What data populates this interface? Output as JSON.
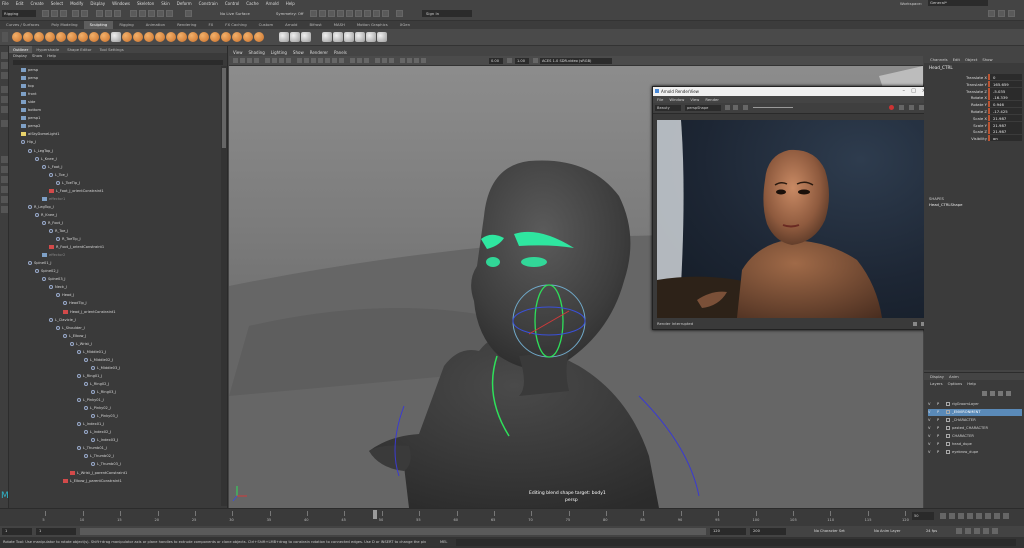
{
  "menubar": [
    "File",
    "Edit",
    "Create",
    "Select",
    "Modify",
    "Display",
    "Windows",
    "Skeleton",
    "Skin",
    "Deform",
    "Constrain",
    "Control",
    "Cache",
    "Arnold",
    "Help"
  ],
  "workspace": {
    "label": "Workspace:",
    "value": "General*"
  },
  "statusline": {
    "mode": "Rigging",
    "no_live": "No Live Surface",
    "symmetry": "Symmetry: Off",
    "signin": "Sign In"
  },
  "shelf_tabs": [
    "Curves / Surfaces",
    "Poly Modeling",
    "Sculpting",
    "Rigging",
    "Animation",
    "Rendering",
    "FX",
    "FX Caching",
    "Custom",
    "Arnold",
    "Bifrost",
    "MASH",
    "Motion Graphics",
    "XGen"
  ],
  "shelf_active": "Sculpting",
  "outliner": {
    "tabs": [
      "Outliner",
      "Hypershade",
      "Shape Editor",
      "Tool Settings"
    ],
    "active_tab": "Outliner",
    "menu": [
      "Display",
      "Show",
      "Help"
    ],
    "rows": [
      {
        "t": "persp",
        "d": 0,
        "k": "c"
      },
      {
        "t": "persp",
        "d": 0,
        "k": "c"
      },
      {
        "t": "top",
        "d": 0,
        "k": "c"
      },
      {
        "t": "front",
        "d": 0,
        "k": "c"
      },
      {
        "t": "side",
        "d": 0,
        "k": "c"
      },
      {
        "t": "bottom",
        "d": 0,
        "k": "c"
      },
      {
        "t": "persp1",
        "d": 0,
        "k": "c"
      },
      {
        "t": "persp2",
        "d": 0,
        "k": "c"
      },
      {
        "t": "aiSkyDomeLight1",
        "d": 0,
        "k": "l"
      },
      {
        "t": "Hip_J",
        "d": 0,
        "k": "j"
      },
      {
        "t": "L_LegTop_J",
        "d": 1,
        "k": "j"
      },
      {
        "t": "L_Knee_J",
        "d": 2,
        "k": "j"
      },
      {
        "t": "L_Foot_J",
        "d": 3,
        "k": "j"
      },
      {
        "t": "L_Toe_J",
        "d": 4,
        "k": "j"
      },
      {
        "t": "L_ToeTip_J",
        "d": 5,
        "k": "j"
      },
      {
        "t": "L_Foot_J_orientConstraint1",
        "d": 4,
        "k": "c"
      },
      {
        "t": "effector1",
        "d": 3,
        "k": "g"
      },
      {
        "t": "R_LegTop_J",
        "d": 1,
        "k": "j"
      },
      {
        "t": "R_Knee_J",
        "d": 2,
        "k": "j"
      },
      {
        "t": "R_Foot_J",
        "d": 3,
        "k": "j"
      },
      {
        "t": "R_Toe_J",
        "d": 4,
        "k": "j"
      },
      {
        "t": "R_ToeTip_J",
        "d": 5,
        "k": "j"
      },
      {
        "t": "R_Foot_J_orientConstraint1",
        "d": 4,
        "k": "c"
      },
      {
        "t": "effector2",
        "d": 3,
        "k": "g"
      },
      {
        "t": "Spine01_J",
        "d": 1,
        "k": "j"
      },
      {
        "t": "Spine02_J",
        "d": 2,
        "k": "j"
      },
      {
        "t": "Spine03_J",
        "d": 3,
        "k": "j"
      },
      {
        "t": "Neck_J",
        "d": 4,
        "k": "j"
      },
      {
        "t": "Head_J",
        "d": 5,
        "k": "j"
      },
      {
        "t": "HeadTip_J",
        "d": 6,
        "k": "j"
      },
      {
        "t": "Head_J_orientConstraint1",
        "d": 6,
        "k": "c"
      },
      {
        "t": "L_Clavicle_J",
        "d": 4,
        "k": "j"
      },
      {
        "t": "L_Shoulder_J",
        "d": 5,
        "k": "j"
      },
      {
        "t": "L_Elbow_J",
        "d": 6,
        "k": "j"
      },
      {
        "t": "L_Wrist_J",
        "d": 7,
        "k": "j"
      },
      {
        "t": "L_Middle01_J",
        "d": 8,
        "k": "j"
      },
      {
        "t": "L_Middle02_J",
        "d": 9,
        "k": "j"
      },
      {
        "t": "L_Middle03_J",
        "d": 10,
        "k": "j"
      },
      {
        "t": "L_Ring01_J",
        "d": 8,
        "k": "j"
      },
      {
        "t": "L_Ring02_J",
        "d": 9,
        "k": "j"
      },
      {
        "t": "L_Ring03_J",
        "d": 10,
        "k": "j"
      },
      {
        "t": "L_Pinky01_J",
        "d": 8,
        "k": "j"
      },
      {
        "t": "L_Pinky02_J",
        "d": 9,
        "k": "j"
      },
      {
        "t": "L_Pinky03_J",
        "d": 10,
        "k": "j"
      },
      {
        "t": "L_Index01_J",
        "d": 8,
        "k": "j"
      },
      {
        "t": "L_Index02_J",
        "d": 9,
        "k": "j"
      },
      {
        "t": "L_Index03_J",
        "d": 10,
        "k": "j"
      },
      {
        "t": "L_Thumb01_J",
        "d": 8,
        "k": "j"
      },
      {
        "t": "L_Thumb02_J",
        "d": 9,
        "k": "j"
      },
      {
        "t": "L_Thumb03_J",
        "d": 10,
        "k": "j"
      },
      {
        "t": "L_Wrist_J_parentConstraint1",
        "d": 7,
        "k": "c"
      },
      {
        "t": "L_Elbow_J_parentConstraint1",
        "d": 6,
        "k": "c"
      }
    ]
  },
  "viewport": {
    "menu": [
      "View",
      "Shading",
      "Lighting",
      "Show",
      "Renderer",
      "Panels"
    ],
    "field_a": "0.00",
    "field_b": "1.00",
    "colorspace": "ACES 1.0 SDR-video (sRGB)",
    "label": "Editing blend shape target: body1",
    "camera": "persp"
  },
  "renderview": {
    "title": "Arnold RenderView",
    "menu": [
      "File",
      "Window",
      "View",
      "Render"
    ],
    "camera_label": "Beauty",
    "camera": "perspShape",
    "status": "Render Interrupted"
  },
  "channelbox": {
    "menu": [
      "Channels",
      "Edit",
      "Object",
      "Show"
    ],
    "object": "Head_CTRL",
    "attrs": [
      {
        "n": "Translate X",
        "v": "0"
      },
      {
        "n": "Translate Y",
        "v": "165.659"
      },
      {
        "n": "Translate Z",
        "v": "-5.035"
      },
      {
        "n": "Rotate X",
        "v": "-16.339"
      },
      {
        "n": "Rotate Y",
        "v": "0.946"
      },
      {
        "n": "Rotate Z",
        "v": "-17.425"
      },
      {
        "n": "Scale X",
        "v": "21.987"
      },
      {
        "n": "Scale Y",
        "v": "21.987"
      },
      {
        "n": "Scale Z",
        "v": "21.987"
      },
      {
        "n": "Visibility",
        "v": "on"
      }
    ],
    "shapes_header": "SHAPES",
    "shape_name": "Head_CTRLShape"
  },
  "layers": {
    "menu": [
      "Display",
      "Anim"
    ],
    "tabs": [
      "Layers",
      "Options",
      "Help"
    ],
    "rows": [
      {
        "v": "V",
        "p": "P",
        "n": "rigGroomLayer",
        "sel": false
      },
      {
        "v": "V",
        "p": "P",
        "n": "_ENVIRONMENT",
        "sel": true
      },
      {
        "v": "V",
        "p": "P",
        "n": "_CHARACTER",
        "sel": false
      },
      {
        "v": "V",
        "p": "P",
        "n": "pasted_CHARACTER",
        "sel": false
      },
      {
        "v": "V",
        "p": "P",
        "n": "CHARACTER",
        "sel": false
      },
      {
        "v": "V",
        "p": "P",
        "n": "head_dupe",
        "sel": false
      },
      {
        "v": "V",
        "p": "P",
        "n": "eyebrow_dupe",
        "sel": false
      }
    ]
  },
  "timeline": {
    "ticks": [
      "5",
      "10",
      "15",
      "20",
      "25",
      "30",
      "35",
      "40",
      "45",
      "50",
      "55",
      "60",
      "65",
      "70",
      "75",
      "80",
      "85",
      "90",
      "95",
      "100",
      "105",
      "110",
      "115",
      "120"
    ],
    "current": "50"
  },
  "range": {
    "start": "1",
    "inner_start": "1",
    "inner_end": "120",
    "end": "120",
    "end2": "200",
    "char_set": "No Character Set",
    "anim_layer": "No Anim Layer",
    "fps": "24 fps"
  },
  "cmdline": {
    "lang": "MEL",
    "text": "Rotate Tool: Use manipulator to rotate object(s). Shift+drag manipulator axis or plane handles to extrude components or clone objects. Ctrl+Shift+LMB+drag to constrain rotation to connected edges. Use D or INSERT to change the piv"
  }
}
